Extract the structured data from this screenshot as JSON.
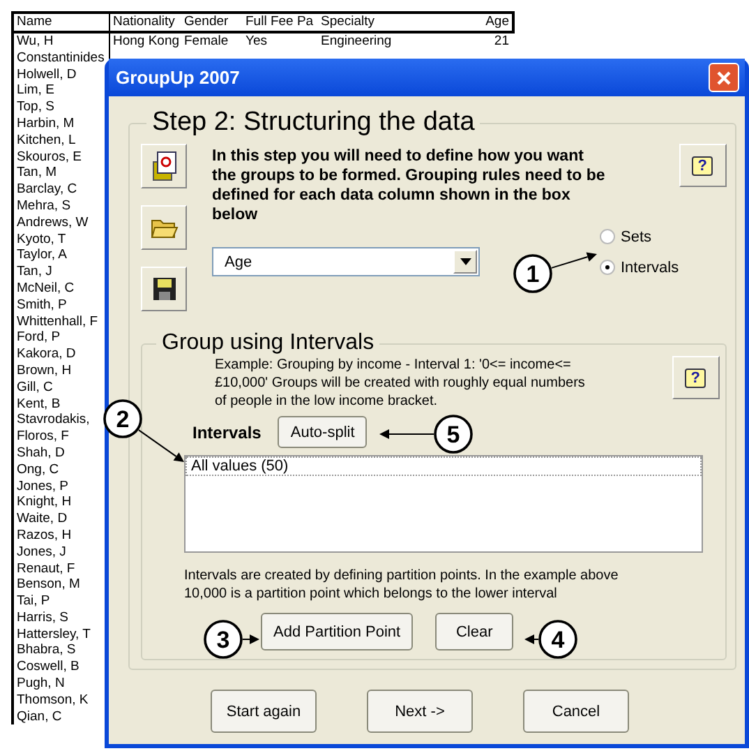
{
  "spreadsheet": {
    "columns": [
      "Name",
      "Nationality",
      "Gender",
      "Full Fee Pa",
      "Specialty",
      "Age"
    ],
    "rows": [
      {
        "cells": [
          "Wu, H",
          "Hong Kong",
          "Female",
          "Yes",
          "Engineering",
          "21"
        ]
      },
      {
        "cells": [
          "Constantinides"
        ]
      },
      {
        "cells": [
          "Holwell, D"
        ]
      },
      {
        "cells": [
          "Lim, E"
        ]
      },
      {
        "cells": [
          "Top, S"
        ]
      },
      {
        "cells": [
          "Harbin, M"
        ]
      },
      {
        "cells": [
          "Kitchen, L"
        ]
      },
      {
        "cells": [
          "Skouros, E"
        ]
      },
      {
        "cells": [
          "Tan, M"
        ]
      },
      {
        "cells": [
          "Barclay, C"
        ]
      },
      {
        "cells": [
          "Mehra, S"
        ]
      },
      {
        "cells": [
          "Andrews, W"
        ]
      },
      {
        "cells": [
          "Kyoto, T"
        ]
      },
      {
        "cells": [
          "Taylor, A"
        ]
      },
      {
        "cells": [
          "Tan, J"
        ]
      },
      {
        "cells": [
          "McNeil, C"
        ]
      },
      {
        "cells": [
          "Smith, P"
        ]
      },
      {
        "cells": [
          "Whittenhall, F"
        ]
      },
      {
        "cells": [
          "Ford, P"
        ]
      },
      {
        "cells": [
          "Kakora, D"
        ]
      },
      {
        "cells": [
          "Brown, H"
        ]
      },
      {
        "cells": [
          "Gill, C"
        ]
      },
      {
        "cells": [
          "Kent, B"
        ]
      },
      {
        "cells": [
          "Stavrodakis,"
        ]
      },
      {
        "cells": [
          "Floros, F"
        ]
      },
      {
        "cells": [
          "Shah, D"
        ]
      },
      {
        "cells": [
          "Ong, C"
        ]
      },
      {
        "cells": [
          "Jones, P"
        ]
      },
      {
        "cells": [
          "Knight, H"
        ]
      },
      {
        "cells": [
          "Waite, D"
        ]
      },
      {
        "cells": [
          "Razos, H"
        ]
      },
      {
        "cells": [
          "Jones, J"
        ]
      },
      {
        "cells": [
          "Renaut, F"
        ]
      },
      {
        "cells": [
          "Benson, M"
        ]
      },
      {
        "cells": [
          "Tai, P"
        ]
      },
      {
        "cells": [
          "Harris, S"
        ]
      },
      {
        "cells": [
          "Hattersley, T"
        ]
      },
      {
        "cells": [
          "Bhabra, S"
        ]
      },
      {
        "cells": [
          "Coswell, B"
        ]
      },
      {
        "cells": [
          "Pugh, N"
        ]
      },
      {
        "cells": [
          "Thomson, K"
        ]
      },
      {
        "cells": [
          "Qian, C"
        ]
      }
    ]
  },
  "window": {
    "title": "GroupUp 2007"
  },
  "step": {
    "title": "Step 2: Structuring the data",
    "instructions": "In this step you will need to define how you want the groups to be formed. Grouping rules need to be defined for each data column shown in the box below",
    "help_button": "?",
    "column_select": {
      "value": "Age"
    },
    "grouping_type": [
      {
        "label": "Sets",
        "selected": false
      },
      {
        "label": "Intervals",
        "selected": true
      }
    ]
  },
  "intervals_group": {
    "title": "Group using Intervals",
    "example": "Example: Grouping by income - Interval 1:  '0<= income<= £10,000'    Groups will be created with roughly equal numbers of people in the low income bracket.",
    "help_button": "?",
    "intervals_label": "Intervals",
    "auto_split_button": "Auto-split",
    "list_items": [
      {
        "label": "All values (50)",
        "selected": true
      }
    ],
    "note": "Intervals are created by defining partition points. In the example above 10,000 is a partition point which belongs to the lower interval",
    "buttons": [
      "Add Partition Point",
      "Clear"
    ]
  },
  "buttons": [
    "Start again",
    "Next ->",
    "Cancel"
  ],
  "callouts": [
    "1",
    "2",
    "3",
    "4",
    "5"
  ]
}
